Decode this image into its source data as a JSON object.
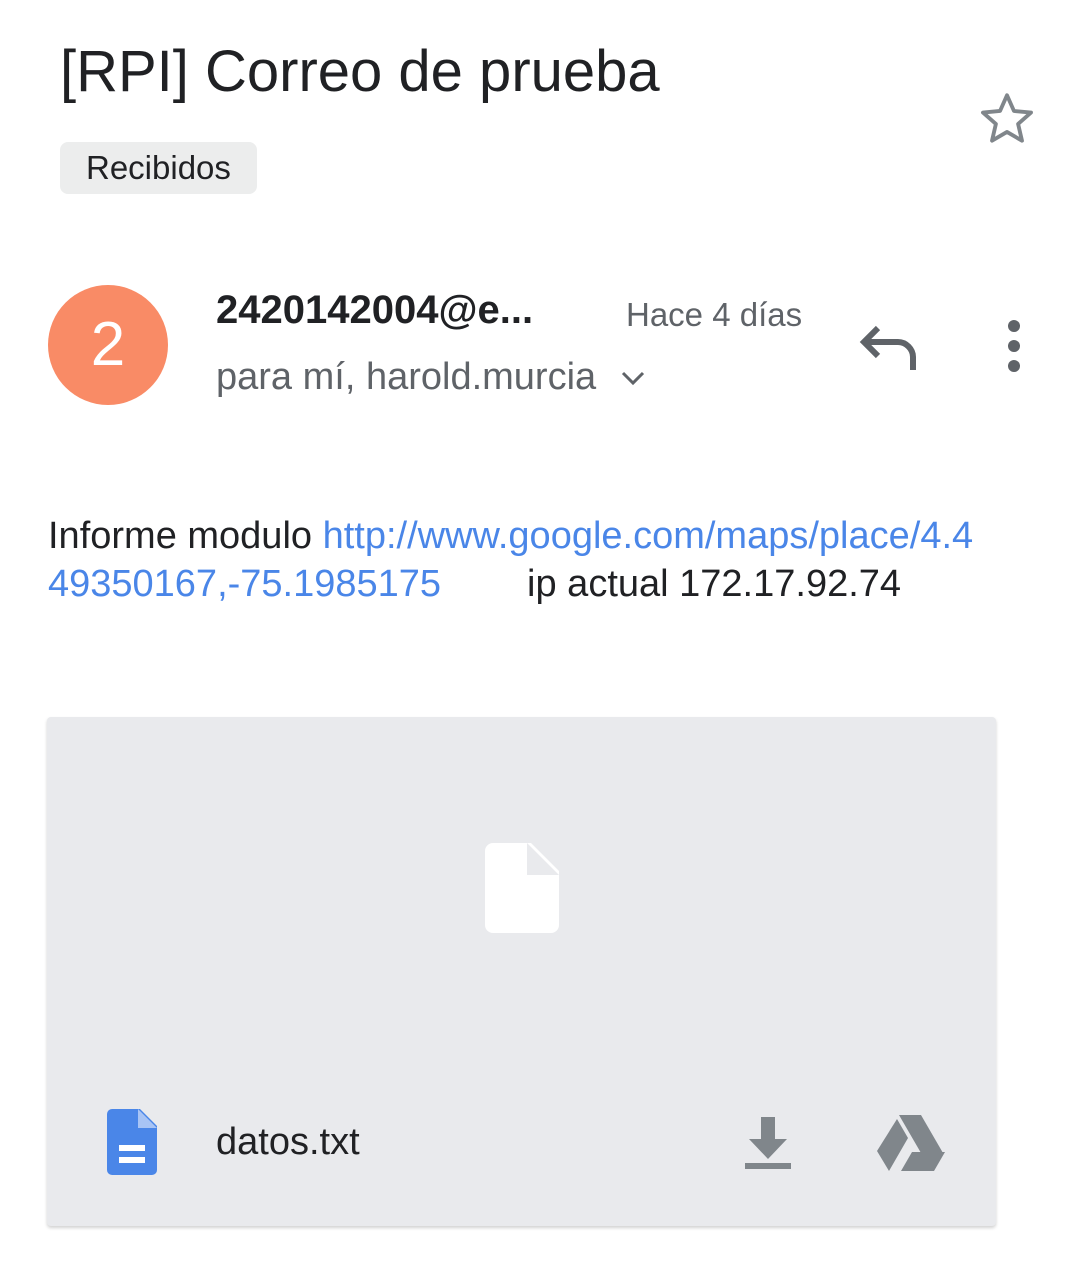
{
  "email": {
    "subject": "[RPI] Correo de prueba",
    "label": "Recibidos",
    "starred": false,
    "sender": {
      "avatar_letter": "2",
      "avatar_color": "#f98b66",
      "name": "2420142004@e...",
      "time": "Hace 4 días",
      "recipients": "para mí, harold.murcia"
    },
    "body": {
      "prefix": "Informe modulo ",
      "link": "http://www.google.com/maps/place/4.449350167,-75.1985175",
      "ip_label": "ip actual",
      "ip_value": "172.17.92.74"
    },
    "attachment": {
      "filename": "datos.txt",
      "icon": "google-docs-icon",
      "actions": [
        "download-icon",
        "drive-icon"
      ]
    }
  },
  "colors": {
    "link": "#4a86e8",
    "doc_icon": "#4a86e8",
    "icon_gray": "#80868b"
  }
}
